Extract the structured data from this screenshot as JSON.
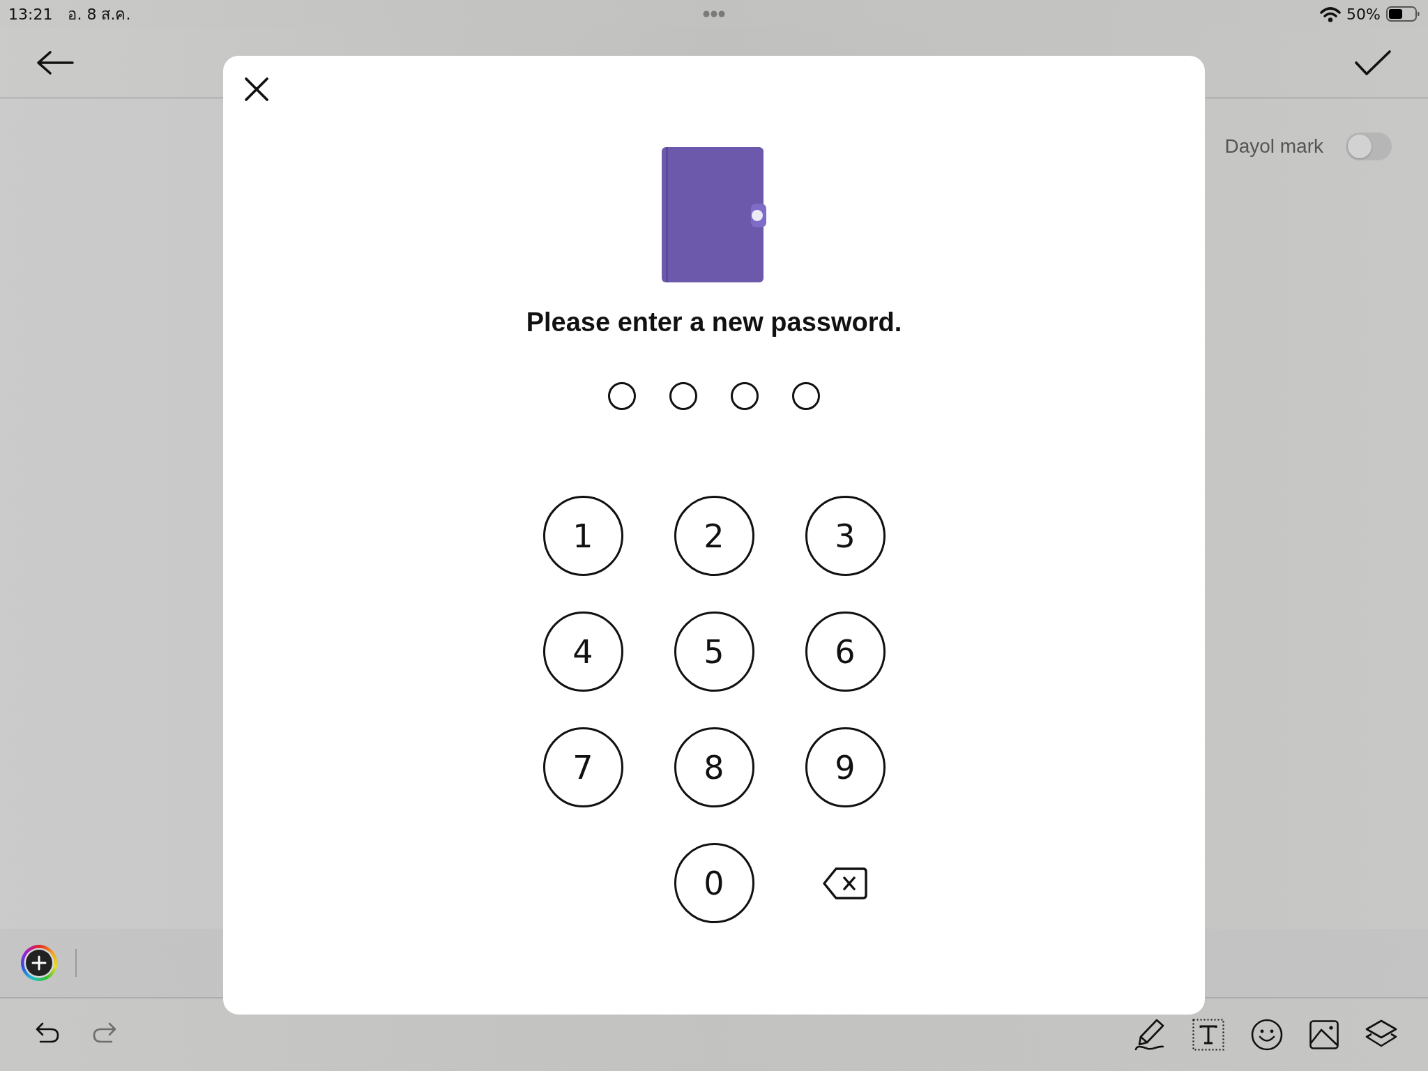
{
  "status_bar": {
    "time": "13:21",
    "date": "อ. 8 ส.ค.",
    "battery": "50%"
  },
  "settings": [
    {
      "label": "Dayol mark",
      "on": false
    }
  ],
  "dialog": {
    "title": "Please enter a new password.",
    "pin_dots": [
      {
        "filled": false
      },
      {
        "filled": false
      },
      {
        "filled": false
      },
      {
        "filled": false
      }
    ],
    "keypad": [
      {
        "kind": "digit",
        "label": "1"
      },
      {
        "kind": "digit",
        "label": "2"
      },
      {
        "kind": "digit",
        "label": "3"
      },
      {
        "kind": "digit",
        "label": "4"
      },
      {
        "kind": "digit",
        "label": "5"
      },
      {
        "kind": "digit",
        "label": "6"
      },
      {
        "kind": "digit",
        "label": "7"
      },
      {
        "kind": "digit",
        "label": "8"
      },
      {
        "kind": "digit",
        "label": "9"
      },
      {
        "kind": "digit",
        "label": "0"
      },
      {
        "kind": "backspace"
      }
    ]
  },
  "history": [
    {
      "kind": "undo",
      "disabled": false
    },
    {
      "kind": "redo",
      "disabled": true
    }
  ],
  "tools": [
    {
      "kind": "pen"
    },
    {
      "kind": "text"
    },
    {
      "kind": "sticker"
    },
    {
      "kind": "photo"
    },
    {
      "kind": "layers"
    }
  ]
}
